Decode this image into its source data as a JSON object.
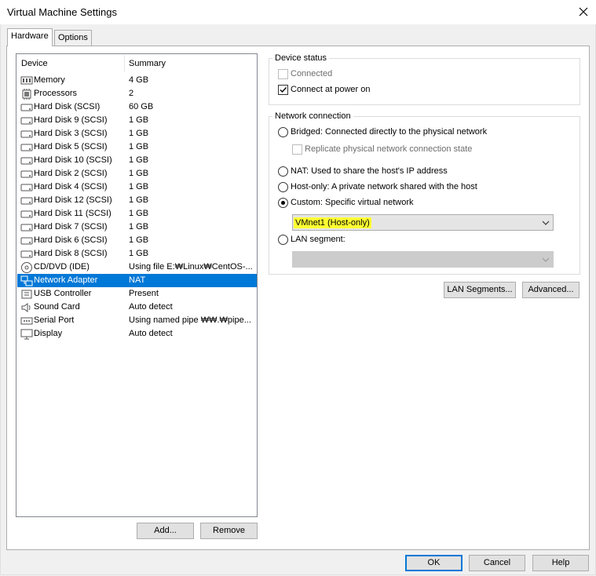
{
  "window": {
    "title": "Virtual Machine Settings"
  },
  "tabs": [
    {
      "label": "Hardware",
      "active": true
    },
    {
      "label": "Options",
      "active": false
    }
  ],
  "device_list": {
    "headers": {
      "device": "Device",
      "summary": "Summary"
    },
    "rows": [
      {
        "name": "Memory",
        "summary": "4 GB",
        "icon": "memory-icon"
      },
      {
        "name": "Processors",
        "summary": "2",
        "icon": "processor-icon"
      },
      {
        "name": "Hard Disk (SCSI)",
        "summary": "60 GB",
        "icon": "hard-disk-icon"
      },
      {
        "name": "Hard Disk 9 (SCSI)",
        "summary": "1 GB",
        "icon": "hard-disk-icon"
      },
      {
        "name": "Hard Disk 3 (SCSI)",
        "summary": "1 GB",
        "icon": "hard-disk-icon"
      },
      {
        "name": "Hard Disk 5 (SCSI)",
        "summary": "1 GB",
        "icon": "hard-disk-icon"
      },
      {
        "name": "Hard Disk 10 (SCSI)",
        "summary": "1 GB",
        "icon": "hard-disk-icon"
      },
      {
        "name": "Hard Disk 2 (SCSI)",
        "summary": "1 GB",
        "icon": "hard-disk-icon"
      },
      {
        "name": "Hard Disk 4 (SCSI)",
        "summary": "1 GB",
        "icon": "hard-disk-icon"
      },
      {
        "name": "Hard Disk 12 (SCSI)",
        "summary": "1 GB",
        "icon": "hard-disk-icon"
      },
      {
        "name": "Hard Disk 11 (SCSI)",
        "summary": "1 GB",
        "icon": "hard-disk-icon"
      },
      {
        "name": "Hard Disk 7 (SCSI)",
        "summary": "1 GB",
        "icon": "hard-disk-icon"
      },
      {
        "name": "Hard Disk 6 (SCSI)",
        "summary": "1 GB",
        "icon": "hard-disk-icon"
      },
      {
        "name": "Hard Disk 8 (SCSI)",
        "summary": "1 GB",
        "icon": "hard-disk-icon"
      },
      {
        "name": "CD/DVD (IDE)",
        "summary": "Using file E:₩Linux₩CentOS-...",
        "icon": "cd-dvd-icon"
      },
      {
        "name": "Network Adapter",
        "summary": "NAT",
        "icon": "network-adapter-icon",
        "selected": true
      },
      {
        "name": "USB Controller",
        "summary": "Present",
        "icon": "usb-icon"
      },
      {
        "name": "Sound Card",
        "summary": "Auto detect",
        "icon": "speaker-icon"
      },
      {
        "name": "Serial Port",
        "summary": "Using named pipe ₩₩.₩pipe...",
        "icon": "serial-port-icon"
      },
      {
        "name": "Display",
        "summary": "Auto detect",
        "icon": "monitor-icon"
      }
    ],
    "buttons": {
      "add": "Add...",
      "remove": "Remove"
    }
  },
  "device_status": {
    "label": "Device status",
    "connected": {
      "label": "Connected",
      "checked": false,
      "enabled": false
    },
    "connect_at_power_on": {
      "label": "Connect at power on",
      "checked": true,
      "enabled": true
    }
  },
  "network_connection": {
    "label": "Network connection",
    "bridged": {
      "label": "Bridged: Connected directly to the physical network",
      "selected": false
    },
    "replicate": {
      "label": "Replicate physical network connection state",
      "checked": false,
      "enabled": false
    },
    "nat": {
      "label": "NAT: Used to share the host's IP address",
      "selected": false
    },
    "host_only": {
      "label": "Host-only: A private network shared with the host",
      "selected": false
    },
    "custom": {
      "label": "Custom: Specific virtual network",
      "selected": true,
      "value": "VMnet1 (Host-only)",
      "highlight_color": "#ffff33"
    },
    "lan_segment": {
      "label": "LAN segment:",
      "selected": false,
      "value": ""
    }
  },
  "action_buttons": {
    "lan_segments": "LAN Segments...",
    "advanced": "Advanced..."
  },
  "footer": {
    "ok": "OK",
    "cancel": "Cancel",
    "help": "Help"
  },
  "colors": {
    "selection": "#0078d7",
    "highlight": "#ffff33",
    "background": "#f0f0f0"
  }
}
